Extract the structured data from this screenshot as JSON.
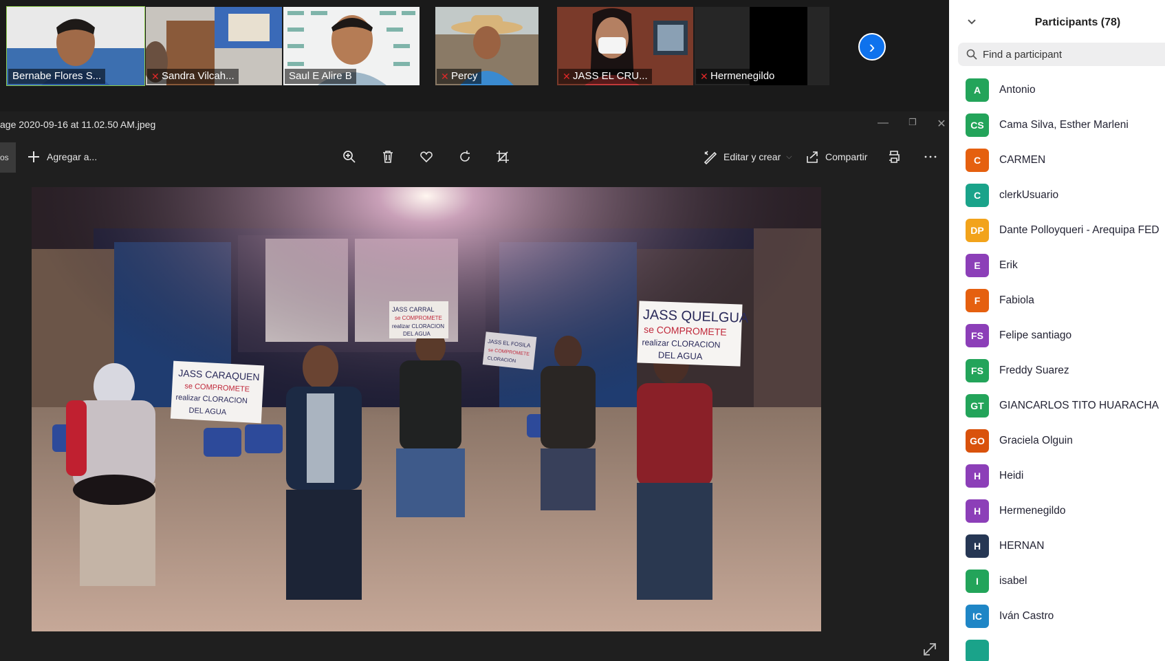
{
  "gallery": {
    "tiles": [
      {
        "name": "Bernabe Flores S...",
        "muted": false
      },
      {
        "name": "Sandra Vilcah...",
        "muted": true
      },
      {
        "name": "Saul E Alire B",
        "muted": false
      },
      {
        "name": "Percy",
        "muted": true
      },
      {
        "name": "JASS EL CRU...",
        "muted": true
      },
      {
        "name": "Hermenegildo",
        "muted": true
      }
    ],
    "next_icon": "chevron-right-icon"
  },
  "viewer": {
    "file_title": "age 2020-09-16 at 11.02.50 AM.jpeg",
    "back_stub": "os",
    "add_label": "Agregar a...",
    "edit_label": "Editar y crear",
    "share_label": "Compartir"
  },
  "photo": {
    "signs": [
      {
        "lines": [
          "JASS CARAQUEN",
          "se COMPROMETE",
          "realizar CLORACION",
          "DEL AGUA"
        ]
      },
      {
        "lines": [
          "JASS CARRAL",
          "se COMPROMETE",
          "realizar CLORACION",
          "DEL AGUA"
        ]
      },
      {
        "lines": [
          "JASS EL FOSILA",
          "se COMPROMETE",
          "CLORACION"
        ]
      },
      {
        "lines": [
          "JASS QUELGUA",
          "se COMPROMETE",
          "realizar CLORACION",
          "DEL AGUA"
        ]
      }
    ]
  },
  "panel": {
    "title": "Participants (78)",
    "search_placeholder": "Find a participant",
    "participants": [
      {
        "initials": "A",
        "name": "Antonio",
        "color": "#23a45a"
      },
      {
        "initials": "CS",
        "name": "Cama Silva, Esther Marleni",
        "color": "#23a45a"
      },
      {
        "initials": "C",
        "name": "CARMEN",
        "color": "#e5600f"
      },
      {
        "initials": "C",
        "name": "clerkUsuario",
        "color": "#1aa38a"
      },
      {
        "initials": "DP",
        "name": "Dante Polloyqueri - Arequipa FED",
        "color": "#f2a31b"
      },
      {
        "initials": "E",
        "name": "Erik",
        "color": "#8c3fb8"
      },
      {
        "initials": "F",
        "name": "Fabiola",
        "color": "#e5600f"
      },
      {
        "initials": "FS",
        "name": "Felipe santiago",
        "color": "#8c3fb8"
      },
      {
        "initials": "FS",
        "name": "Freddy Suarez",
        "color": "#23a45a"
      },
      {
        "initials": "GT",
        "name": "GIANCARLOS TITO HUARACHA",
        "color": "#23a45a"
      },
      {
        "initials": "GO",
        "name": "Graciela Olguin",
        "color": "#d9520c"
      },
      {
        "initials": "H",
        "name": "Heidi",
        "color": "#8c3fb8"
      },
      {
        "initials": "H",
        "name": "Hermenegildo",
        "color": "#8c3fb8"
      },
      {
        "initials": "H",
        "name": "HERNAN",
        "color": "#263754"
      },
      {
        "initials": "I",
        "name": "isabel",
        "color": "#23a45a"
      },
      {
        "initials": "IC",
        "name": "Iván Castro",
        "color": "#1f86c6"
      },
      {
        "initials": "",
        "name": "",
        "color": "#1aa38a"
      }
    ]
  }
}
